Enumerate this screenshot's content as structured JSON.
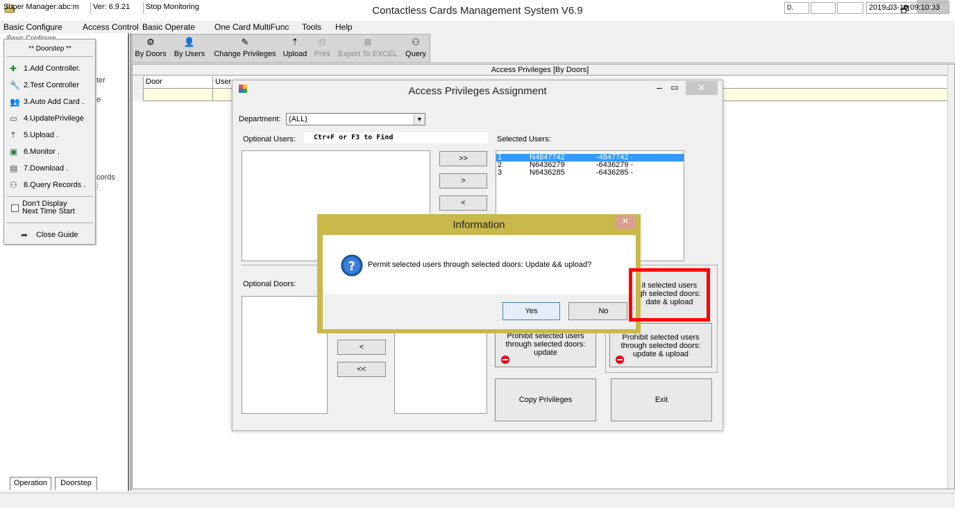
{
  "window": {
    "title": "Contactless Cards Management System  V6.9",
    "min_glyph": "–",
    "max_glyph": "🗗",
    "close_glyph": "✕"
  },
  "menu": [
    "Basic Configure",
    "Access Control",
    "Basic Operate",
    "One Card MultiFunc",
    "Tools",
    "Help"
  ],
  "tree_partial": {
    "top": "Basic Configure",
    "a": "ter",
    "b": "e",
    "c": "cords",
    "d": ":"
  },
  "guide": {
    "header": "** Doorstep **",
    "items": [
      {
        "icon": "plus-icon",
        "glyph": "✚",
        "label": "1.Add Controller."
      },
      {
        "icon": "wrench-icon",
        "glyph": "🔧",
        "label": "2.Test Controller"
      },
      {
        "icon": "users-icon",
        "glyph": "👥",
        "label": "3.Auto Add Card ."
      },
      {
        "icon": "card-icon",
        "glyph": "▭",
        "label": "4.UpdatePrivilege"
      },
      {
        "icon": "upload-icon",
        "glyph": "⇡",
        "label": "5.Upload      ."
      },
      {
        "icon": "monitor-icon",
        "glyph": "▣",
        "label": "6.Monitor      ."
      },
      {
        "icon": "download-icon",
        "glyph": "▤",
        "label": "7.Download      ."
      },
      {
        "icon": "binoculars-icon",
        "glyph": "⚇",
        "label": "8.Query Records ."
      }
    ],
    "dont_display_line1": "Don't Display",
    "dont_display_line2": "Next Time Start",
    "close_label": "Close Guide"
  },
  "tabs": [
    "Operation",
    "Doorstep"
  ],
  "toolbar": [
    {
      "label": "By Doors",
      "icon": "doors-icon",
      "glyph": "⚙",
      "enabled": true
    },
    {
      "label": "By Users",
      "icon": "users-icon",
      "glyph": "👤",
      "enabled": true
    },
    {
      "label": "Change Privileges",
      "icon": "pen-icon",
      "glyph": "✎",
      "enabled": true
    },
    {
      "label": "Upload",
      "icon": "upload-icon",
      "glyph": "⇡",
      "enabled": true
    },
    {
      "label": "Print",
      "icon": "print-icon",
      "glyph": "⎙",
      "enabled": false
    },
    {
      "label": "Export To EXCEL",
      "icon": "excel-icon",
      "glyph": "⊠",
      "enabled": false
    },
    {
      "label": "Query",
      "icon": "binoculars-icon",
      "glyph": "⚇",
      "enabled": true
    }
  ],
  "grid": {
    "caption": "Access Privileges [By Doors]",
    "col_door": "Door",
    "col_user": "User"
  },
  "assign": {
    "title": "Access Privileges Assignment",
    "department_label": "Department:",
    "department_value": "(ALL)",
    "optional_users_label": "Optional Users:",
    "find_hint": "Ctr+F  or F3 to Find",
    "selected_users_label": "Selected Users:",
    "optional_doors_label": "Optional Doors:",
    "btn_add_all": ">>",
    "btn_add": ">",
    "btn_remove": "<",
    "btn_door_remove": "<",
    "btn_door_remove_all": "<<",
    "selected_users": [
      {
        "no": "1",
        "name": "N4847742",
        "card": "-4847742 -"
      },
      {
        "no": "2",
        "name": "N6436279",
        "card": "-6436279 -"
      },
      {
        "no": "3",
        "name": "N6436285",
        "card": "-6436285 -"
      }
    ],
    "permit_upload_line1": "it selected users",
    "permit_upload_line2": "gh selected doors:",
    "permit_upload_line3": "date & upload",
    "prohibit_update_line1": "Prohibit selected users",
    "prohibit_update_line2": "through selected doors:",
    "prohibit_update_line3": "update",
    "prohibit_upload_line1": "Prohibit selected users",
    "prohibit_upload_line2": "through selected doors:",
    "prohibit_upload_line3": "update & upload",
    "copy_label": "Copy Privileges",
    "exit_label": "Exit"
  },
  "info": {
    "title": "Information",
    "message": "Permit selected users through selected doors: Update && upload?",
    "yes": "Yes",
    "no": "No",
    "close_glyph": "✕"
  },
  "status": {
    "user": "Super Manager:abc:m",
    "version": "Ver: 6.9.21",
    "monitoring": "Stop Monitoring",
    "count": "0.",
    "datetime": "2019-03-10 09:10:33"
  },
  "colors": {
    "selection": "#3399ff",
    "dialog_border": "#c9b84a",
    "highlight": "#ff0000",
    "stop_icon": "#e0001a"
  }
}
